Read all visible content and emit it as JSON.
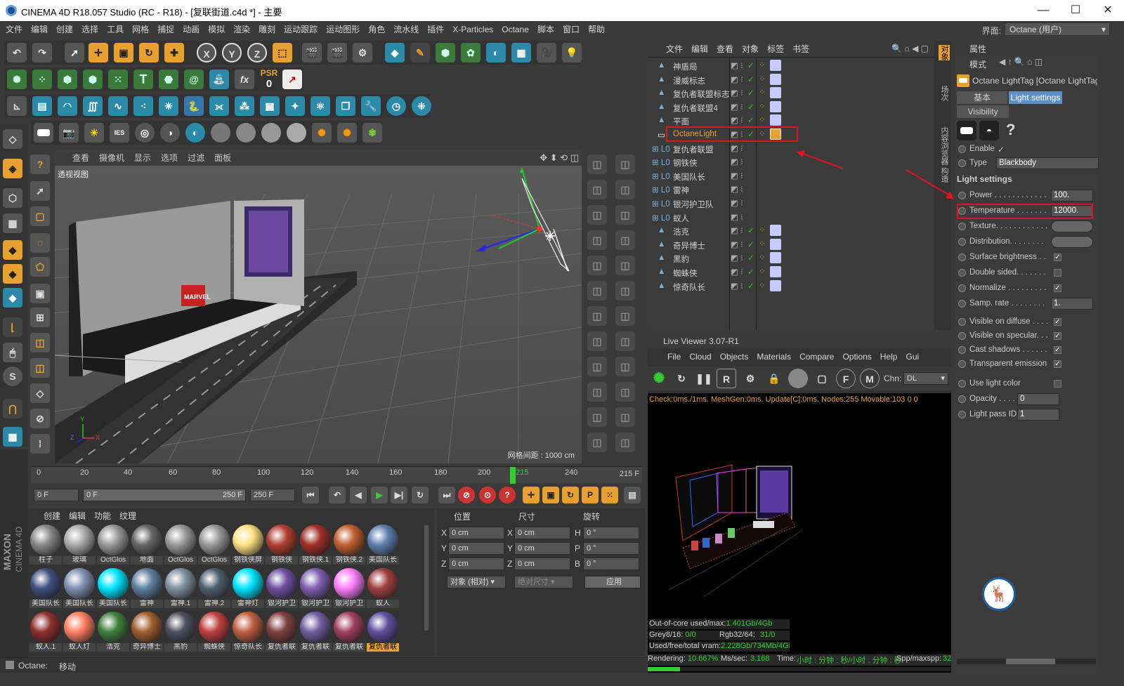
{
  "window": {
    "title": "CINEMA 4D R18.057 Studio (RC - R18) - [复联街道.c4d *] - 主要",
    "minimize": "—",
    "maximize": "☐",
    "close": "✕"
  },
  "menubar": {
    "items": [
      "文件",
      "编辑",
      "创建",
      "选择",
      "工具",
      "网格",
      "捕捉",
      "动画",
      "模拟",
      "渲染",
      "雕刻",
      "运动跟踪",
      "运动图形",
      "角色",
      "流水线",
      "插件",
      "X-Particles",
      "Octane",
      "脚本",
      "窗口",
      "帮助"
    ],
    "layout_label": "界面:",
    "layout_value": "Octane (用户)"
  },
  "toolbar": {
    "undo": "↶",
    "x": "X",
    "y": "Y",
    "z": "Z",
    "psr": "PSR",
    "psr_val": "0",
    "text": "T",
    "fx": "fx",
    "ies": "IES"
  },
  "viewport": {
    "menus": [
      "查看",
      "摄像机",
      "显示",
      "选项",
      "过滤",
      "面板"
    ],
    "label": "透视视图",
    "grid_info": "网格间距 : 1000 cm",
    "axis_y": "Y",
    "axis_z": "Z",
    "axis_x": "X",
    "poster_text": "MARVEL"
  },
  "timeline": {
    "ticks": [
      "0",
      "20",
      "40",
      "60",
      "80",
      "100",
      "120",
      "140",
      "160",
      "180",
      "200",
      "215",
      "240"
    ],
    "current": "215 F"
  },
  "playback": {
    "start": "0 F",
    "range_start": "0 F",
    "range_end": "250 F",
    "end": "250 F"
  },
  "materials": {
    "menus": [
      "创建",
      "编辑",
      "功能",
      "纹理"
    ],
    "items": [
      {
        "name": "柱子",
        "color": "#888"
      },
      {
        "name": "玻璃",
        "color": "#aaa"
      },
      {
        "name": "OctGlos",
        "color": "#999"
      },
      {
        "name": "地面",
        "color": "#666"
      },
      {
        "name": "OctGlos",
        "color": "#999"
      },
      {
        "name": "OctGlos",
        "color": "#999"
      },
      {
        "name": "钢铁侠屏",
        "color": "#ffe080"
      },
      {
        "name": "钢铁侠",
        "color": "#b04030"
      },
      {
        "name": "钢铁侠.1",
        "color": "#a03028"
      },
      {
        "name": "钢铁侠.2",
        "color": "#c06030"
      },
      {
        "name": "美国队长",
        "color": "#6080b0"
      },
      {
        "name": "美国队长",
        "color": "#405080"
      },
      {
        "name": "美国队长",
        "color": "#8090b0"
      },
      {
        "name": "美国队长",
        "color": "#00e5ff"
      },
      {
        "name": "雷神",
        "color": "#6080a0"
      },
      {
        "name": "雷神.1",
        "color": "#8090a0"
      },
      {
        "name": "雷神.2",
        "color": "#506070"
      },
      {
        "name": "雷神灯",
        "color": "#00e5ff"
      },
      {
        "name": "银河护卫",
        "color": "#7050a0"
      },
      {
        "name": "银河护卫",
        "color": "#8060b0"
      },
      {
        "name": "银河护卫",
        "color": "#ff80ff"
      },
      {
        "name": "蚁人",
        "color": "#a04040"
      },
      {
        "name": "蚁人.1",
        "color": "#903030"
      },
      {
        "name": "蚁人灯",
        "color": "#ff8060"
      },
      {
        "name": "浩克",
        "color": "#408040"
      },
      {
        "name": "奇异博士",
        "color": "#a06030"
      },
      {
        "name": "黑豹",
        "color": "#505060"
      },
      {
        "name": "蜘蛛侠",
        "color": "#c04040"
      },
      {
        "name": "惊奇队长",
        "color": "#c06040"
      },
      {
        "name": "复仇者联",
        "color": "#804040"
      },
      {
        "name": "复仇者联",
        "color": "#7060a0"
      },
      {
        "name": "复仇者联",
        "color": "#a04060"
      },
      {
        "name": "复仇者联",
        "color": "#6050a0"
      }
    ],
    "selected_index": 32
  },
  "coordinates": {
    "headers": [
      "位置",
      "尺寸",
      "旋转"
    ],
    "rows": [
      {
        "axis": "X",
        "pos": "0 cm",
        "size_axis": "X",
        "size": "0 cm",
        "rot_axis": "H",
        "rot": "0 °"
      },
      {
        "axis": "Y",
        "pos": "0 cm",
        "size_axis": "Y",
        "size": "0 cm",
        "rot_axis": "P",
        "rot": "0 °"
      },
      {
        "axis": "Z",
        "pos": "0 cm",
        "size_axis": "Z",
        "size": "0 cm",
        "rot_axis": "B",
        "rot": "0 °"
      }
    ],
    "mode": "对象 (相对)",
    "size_mode": "绝对尺寸",
    "apply": "应用"
  },
  "object_manager": {
    "menus": [
      "文件",
      "编辑",
      "查看",
      "对象",
      "标签",
      "书签"
    ],
    "objects": [
      {
        "name": "神盾局",
        "type": "poly"
      },
      {
        "name": "漫威标志",
        "type": "poly"
      },
      {
        "name": "复仇者联盟标志",
        "type": "poly"
      },
      {
        "name": "复仇者联盟4",
        "type": "poly"
      },
      {
        "name": "平面",
        "type": "poly"
      },
      {
        "name": "OctaneLight",
        "type": "light"
      },
      {
        "name": "复仇者联盟",
        "type": "null"
      },
      {
        "name": "钢铁侠",
        "type": "null"
      },
      {
        "name": "美国队长",
        "type": "null"
      },
      {
        "name": "雷神",
        "type": "null"
      },
      {
        "name": "银河护卫队",
        "type": "null"
      },
      {
        "name": "蚁人",
        "type": "null"
      },
      {
        "name": "浩克",
        "type": "poly"
      },
      {
        "name": "奇异博士",
        "type": "poly"
      },
      {
        "name": "黑豹",
        "type": "poly"
      },
      {
        "name": "蜘蛛侠",
        "type": "poly"
      },
      {
        "name": "惊奇队长",
        "type": "poly"
      }
    ],
    "side_tabs": [
      "对象",
      "场次",
      "内容浏览器",
      "构造"
    ]
  },
  "live_viewer": {
    "title": "Live Viewer 3.07-R1",
    "menus": [
      "File",
      "Cloud",
      "Objects",
      "Materials",
      "Compare",
      "Options",
      "Help",
      "Gui"
    ],
    "chn_label": "Chn:",
    "chn_value": "DL",
    "check_line": "Check:0ms./1ms. MeshGen:0ms. Update[C]:0ms. Nodes:255 Movable:103  0 0",
    "outofcore": "Out-of-core used/max:",
    "outofcore_val": "1.401Gb/4Gb",
    "grey_lbl": "Grey8/16:",
    "grey_val": "0/0",
    "rgb_lbl": "Rgb32/64:",
    "rgb_val": "31/0",
    "vram_lbl": "Used/free/total vram:",
    "vram_val": "2.228Gb/734Mb/4Gb",
    "rendering_lbl": "Rendering:",
    "rendering_val": "10.667%",
    "ms_lbl": "Ms/sec:",
    "ms_val": "3.168",
    "time_lbl": "Time:",
    "time_val": "小时 : 分钟 : 秒/小时 : 分钟 : 秒",
    "spp_lbl": "Spp/maxspp:",
    "spp_val": "32",
    "progress": 0.10667
  },
  "attributes": {
    "title": "属性",
    "mode": "模式",
    "tag_title": "Octane LightTag [Octane LightTag]",
    "tabs": [
      "基本",
      "Light settings",
      "Visibility"
    ],
    "enable_label": "Enable",
    "type_label": "Type",
    "type_value": "Blackbody",
    "section": "Light settings",
    "rows": [
      {
        "label": "Power . . . . . . . . . . . .",
        "value": "100."
      },
      {
        "label": "Temperature . . . . . . .",
        "value": "12000."
      },
      {
        "label": "Texture. . . . . . . . . . . .",
        "value": ""
      },
      {
        "label": "Distribution. . . . . . . .",
        "value": ""
      },
      {
        "label": "Surface brightness . .",
        "check": true
      },
      {
        "label": "Double sided. . . . . . .",
        "check": false
      },
      {
        "label": "Normalize . . . . . . . . .",
        "check": true
      },
      {
        "label": "Samp. rate . . . . . . . .",
        "value": "1."
      },
      {
        "label": "Visible on diffuse . . . .",
        "check": true
      },
      {
        "label": "Visible on specular. . .",
        "check": true
      },
      {
        "label": "Cast shadows . . . . . .",
        "check": true
      },
      {
        "label": "Transparent emission",
        "check": true
      },
      {
        "label": "Use light color",
        "check": false
      },
      {
        "label": "Opacity . . . .",
        "value": "0"
      },
      {
        "label": "Light pass ID",
        "value": "1"
      }
    ]
  },
  "statusbar": {
    "label": "Octane:",
    "text": "移动"
  },
  "brand": {
    "maxon": "MAXON",
    "c4d": "CINEMA 4D"
  }
}
